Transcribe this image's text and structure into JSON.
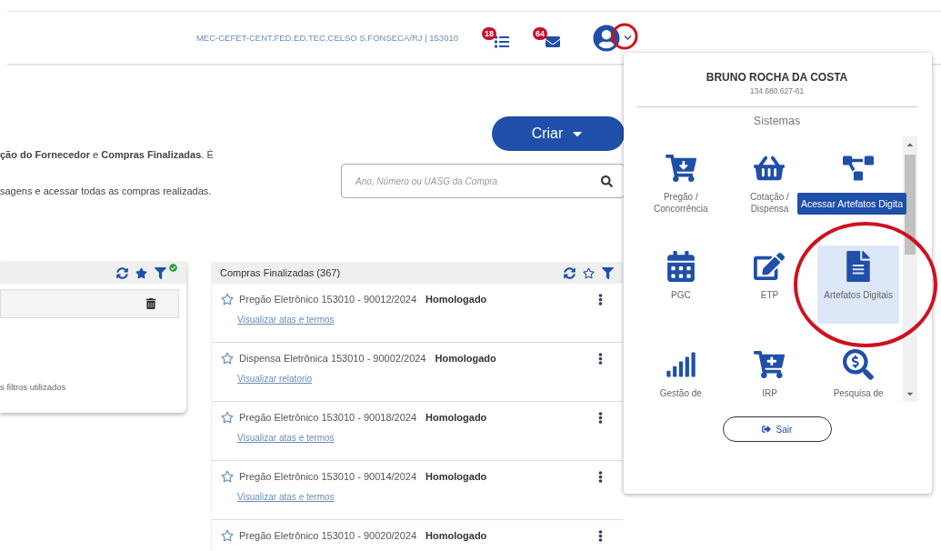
{
  "header": {
    "organization": "MEC-CEFET-CENT.FED.ED.TEC.CELSO S.FONSECA/RJ | 153010",
    "notifications": [
      {
        "kind": "tasks",
        "count": "18"
      },
      {
        "kind": "messages",
        "count": "64"
      }
    ]
  },
  "intro": [
    "**ção do Fornecedor** e **Compras Finalizadas**. É",
    "sagens e acessar todas as compras realizadas."
  ],
  "create_button": "Criar",
  "search": {
    "placeholder": "Ano, Número ou UASG da Compra"
  },
  "left_panel": {
    "favorites_only": true,
    "filter_applied": true,
    "note": "s filtros utilizados"
  },
  "finished": {
    "title": "Compras Finalizadas (367)",
    "favorites_only": false,
    "items": [
      {
        "title": "Pregão Eletrônico 153010 - 90012/2024",
        "status": "Homologado",
        "link": "Visualizar atas e termos",
        "favorite": false
      },
      {
        "title": "Dispensa Eletrônica 153010 - 90002/2024",
        "status": "Homologado",
        "link": "Visualizar relatorio",
        "favorite": false
      },
      {
        "title": "Pregão Eletrônico 153010 - 90018/2024",
        "status": "Homologado",
        "link": "Visualizar atas e termos",
        "favorite": false
      },
      {
        "title": "Pregão Eletrônico 153010 - 90014/2024",
        "status": "Homologado",
        "link": "Visualizar atas e termos",
        "favorite": false
      },
      {
        "title": "Pregão Eletrônico 153010 - 90020/2024",
        "status": "Homologado",
        "favorite": false
      }
    ]
  },
  "user_menu": {
    "open": true,
    "name": "BRUNO ROCHA DA COSTA",
    "cpf": "134.680.627-61",
    "section": "Sistemas",
    "tooltip": "Acessar Artefatos Digita",
    "systems": [
      {
        "kind": "cart-down",
        "label": "Pregão / Concorrência",
        "selected": false
      },
      {
        "kind": "basket",
        "label": "Cotação / Dispensa",
        "selected": false
      },
      {
        "kind": "diagram",
        "selected": false
      },
      {
        "kind": "calendar",
        "label": "PGC",
        "selected": false
      },
      {
        "kind": "edit",
        "label": "ETP",
        "selected": false
      },
      {
        "kind": "document",
        "label": "Artefatos Digitais",
        "selected": true
      },
      {
        "kind": "chart",
        "label": "Gestão de",
        "selected": false
      },
      {
        "kind": "cart-plus",
        "label": "IRP",
        "selected": false
      },
      {
        "kind": "search-dollar",
        "label": "Pesquisa de",
        "selected": false
      }
    ],
    "logout": "Sair"
  }
}
